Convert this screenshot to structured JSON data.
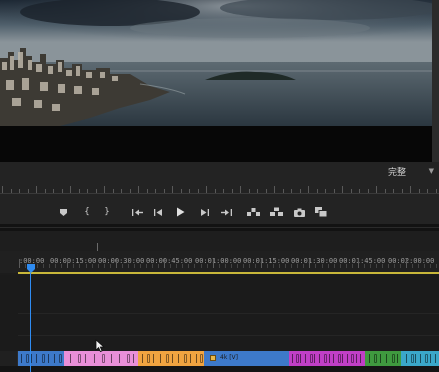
{
  "monitor": {
    "resolution_select": {
      "value": "完整",
      "chevron_icon": "chevron-down-icon"
    }
  },
  "transport": {
    "buttons": [
      {
        "name": "add-marker-button",
        "icon": "marker-icon"
      },
      {
        "name": "mark-in-button",
        "icon": "mark-in-icon",
        "glyph": "{"
      },
      {
        "name": "mark-out-button",
        "icon": "mark-out-icon",
        "glyph": "}"
      },
      {
        "name": "go-to-in-button",
        "icon": "go-to-in-icon"
      },
      {
        "name": "step-back-button",
        "icon": "step-back-icon"
      },
      {
        "name": "play-button",
        "icon": "play-icon"
      },
      {
        "name": "step-forward-button",
        "icon": "step-forward-icon"
      },
      {
        "name": "go-to-out-button",
        "icon": "go-to-out-icon"
      },
      {
        "name": "lift-button",
        "icon": "lift-icon"
      },
      {
        "name": "extract-button",
        "icon": "extract-icon"
      },
      {
        "name": "export-frame-button",
        "icon": "camera-icon"
      },
      {
        "name": "comparison-view-button",
        "icon": "comparison-icon"
      }
    ]
  },
  "timeline": {
    "ruler_labels": [
      ":00:00",
      "00:00:15:00",
      "00:00:30:00",
      "00:00:45:00",
      "00:01:00:00",
      "00:01:15:00",
      "00:01:30:00",
      "00:01:45:00",
      "00:02:00:00"
    ],
    "clip_label": "4k [V]",
    "colors": {
      "playhead": "#2f8cf2",
      "work_area": "#c8b73a",
      "clip_blue": "#3d79c9",
      "clip_pink": "#e98fd8",
      "clip_orange": "#f0a440",
      "clip_violet": "#c03fc6",
      "clip_green": "#3f9a3f",
      "clip_cyan": "#3aa7c9"
    }
  }
}
